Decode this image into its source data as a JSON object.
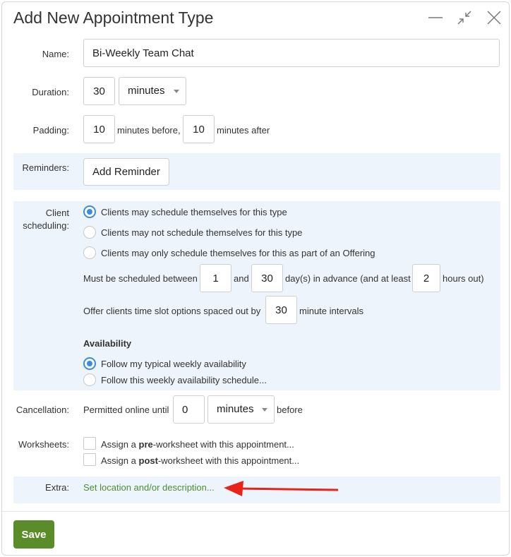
{
  "dialog": {
    "title": "Add New Appointment Type",
    "icons": {
      "minimize": "minimize-icon",
      "collapse": "collapse-arrows-icon",
      "close": "close-icon"
    }
  },
  "name": {
    "label": "Name:",
    "value": "Bi-Weekly Team Chat"
  },
  "duration": {
    "label": "Duration:",
    "value": "30",
    "unit": "minutes"
  },
  "padding": {
    "label": "Padding:",
    "before_value": "10",
    "before_text": "minutes before,",
    "after_value": "10",
    "after_text": "minutes after"
  },
  "reminders": {
    "label": "Reminders:",
    "button": "Add Reminder"
  },
  "scheduling": {
    "label_line1": "Client",
    "label_line2": "scheduling:",
    "options": [
      {
        "label": "Clients may schedule themselves for this type",
        "selected": true
      },
      {
        "label": "Clients may not schedule themselves for this type",
        "selected": false
      },
      {
        "label": "Clients may only schedule themselves for this as part of an Offering",
        "selected": false
      }
    ],
    "between_text": "Must be scheduled between",
    "min_days": "1",
    "and_text": "and",
    "max_days": "30",
    "advance_text": "day(s) in advance (and at least",
    "min_hours": "2",
    "hours_text": "hours out)",
    "interval_text": "Offer clients time slot options spaced out by",
    "interval_value": "30",
    "interval_suffix": "minute intervals",
    "availability_heading": "Availability",
    "availability_options": [
      {
        "label": "Follow my typical weekly availability",
        "selected": true
      },
      {
        "label": "Follow this weekly availability schedule...",
        "selected": false
      }
    ]
  },
  "cancellation": {
    "label": "Cancellation:",
    "prefix": "Permitted online until",
    "value": "0",
    "unit": "minutes",
    "suffix": "before"
  },
  "worksheets": {
    "label": "Worksheets:",
    "items": [
      {
        "prefix": "Assign a",
        "bold": "pre",
        "suffix": "-worksheet with this appointment...",
        "checked": false
      },
      {
        "prefix": "Assign a",
        "bold": "post",
        "suffix": "-worksheet with this appointment...",
        "checked": false
      }
    ]
  },
  "extra": {
    "label": "Extra:",
    "link": "Set location and/or description..."
  },
  "footer": {
    "save": "Save"
  },
  "colors": {
    "accent_blue": "#3d8be0",
    "save_green": "#5b8c2a",
    "link_green": "#4a8f2f",
    "band_bg": "#eef4fb",
    "annotation_arrow": "#e8241a"
  }
}
